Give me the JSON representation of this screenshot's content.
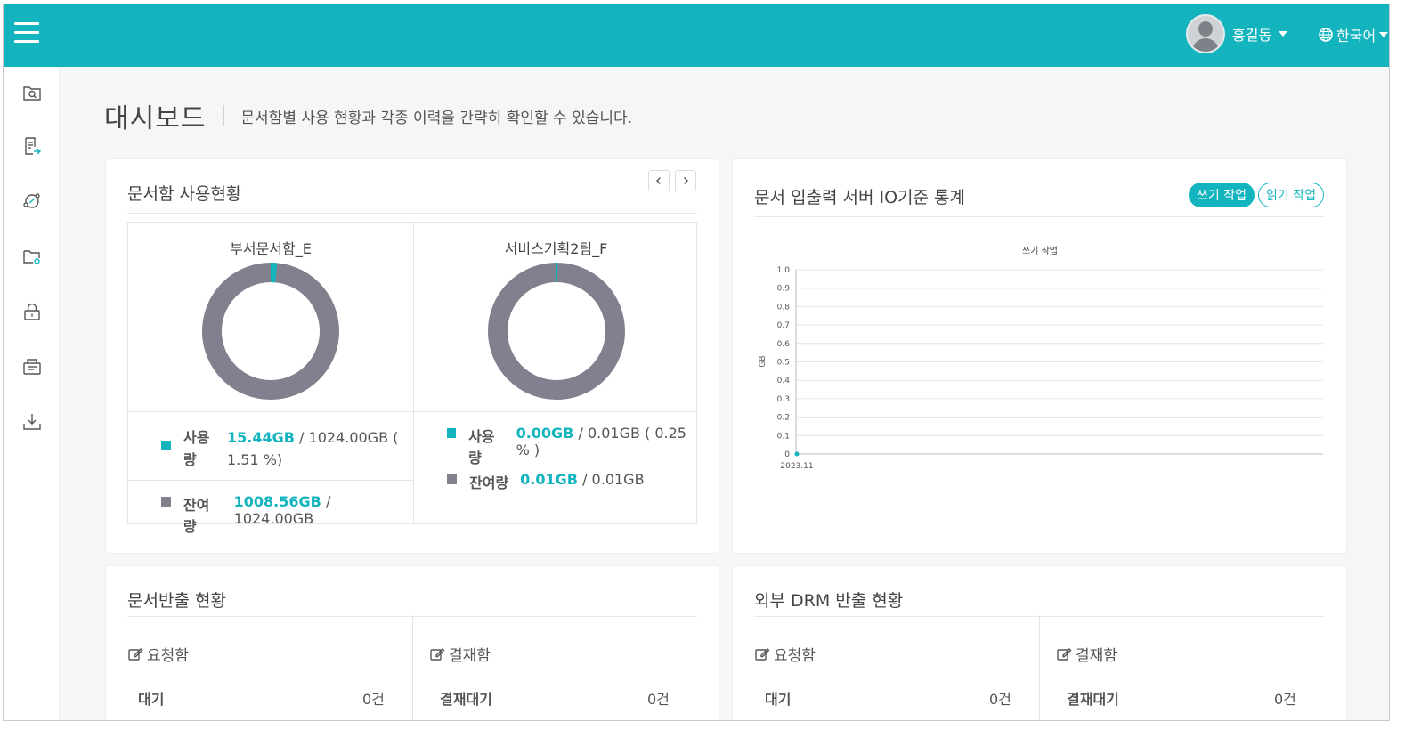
{
  "header": {
    "user_name": "홍길동",
    "language": "한국어"
  },
  "sidebar": {
    "items": [
      {
        "icon": "folder-search-icon"
      },
      {
        "icon": "document-export-icon"
      },
      {
        "icon": "share-link-icon"
      },
      {
        "icon": "folder-settings-icon"
      },
      {
        "icon": "lock-icon"
      },
      {
        "icon": "inbox-document-icon"
      },
      {
        "icon": "download-icon"
      }
    ]
  },
  "page": {
    "title": "대시보드",
    "description": "문서함별 사용 현황과 각종 이력을 간략히 확인할 수 있습니다."
  },
  "usage_panel": {
    "title": "문서함 사용현황",
    "boxes": [
      {
        "name": "부서문서함_E",
        "used_label": "사용량",
        "used_value": "15.44GB",
        "used_total": "/ 1024.00GB ( 1.51 %)",
        "remain_label": "잔여량",
        "remain_value": "1008.56GB",
        "remain_total": "/ 1024.00GB",
        "used_percent": 1.51
      },
      {
        "name": "서비스기획2팀_F",
        "used_label": "사용량",
        "used_value": "0.00GB",
        "used_total": "/ 0.01GB ( 0.25 % )",
        "remain_label": "잔여량",
        "remain_value": "0.01GB",
        "remain_total": "/ 0.01GB",
        "used_percent": 0.25
      }
    ]
  },
  "io_panel": {
    "title": "문서 입출력 서버 IO기준 통계",
    "tabs": [
      "쓰기 작업",
      "읽기 작업"
    ],
    "active_tab": 0
  },
  "chart_data": {
    "type": "line",
    "title": "쓰기 작업",
    "ylabel": "GB",
    "xlabel": "",
    "categories": [
      "2023.11"
    ],
    "series": [
      {
        "values": [
          0
        ]
      }
    ],
    "ylim": [
      0,
      1.0
    ],
    "yticks": [
      "1.0",
      "0.9",
      "0.8",
      "0.7",
      "0.6",
      "0.5",
      "0.4",
      "0.3",
      "0.2",
      "0.1",
      "0"
    ],
    "grid": true,
    "color": "#14b4bf"
  },
  "export_panel": {
    "title": "문서반출 현황",
    "left": {
      "title": "요청함",
      "row_label": "대기",
      "row_value": "0건"
    },
    "right": {
      "title": "결재함",
      "row_label": "결재대기",
      "row_value": "0건"
    }
  },
  "drm_panel": {
    "title": "외부 DRM 반출 현황",
    "left": {
      "title": "요청함",
      "row_label": "대기",
      "row_value": "0건"
    },
    "right": {
      "title": "결재함",
      "row_label": "결재대기",
      "row_value": "0건"
    }
  },
  "colors": {
    "accent": "#14b4bf",
    "donut_gray": "#80808e"
  }
}
